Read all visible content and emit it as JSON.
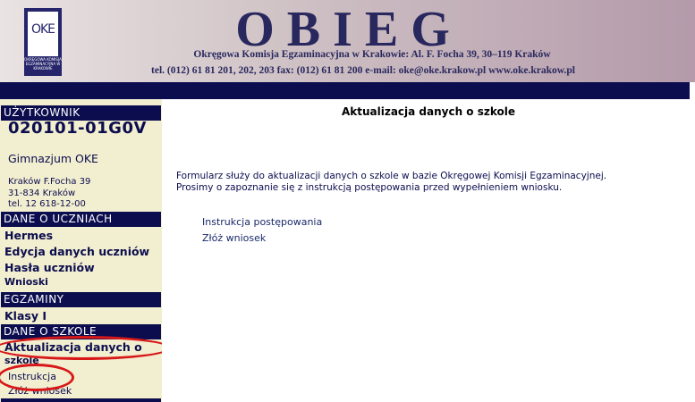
{
  "header": {
    "title": "OBIEG",
    "logo_letters": "OKE",
    "logo_text": "OKRĘGOWA KOMISJA EGZAMINACYJNA W KRAKOWIE",
    "subtitle": "Okręgowa Komisja Egzaminacyjna w Krakowie:  Al. F. Focha 39, 30–119 Kraków",
    "contact": "tel. (012) 61 81 201, 202, 203  fax: (012) 61 81 200  e-mail: oke@oke.krakow.pl   www.oke.krakow.pl"
  },
  "sidebar": {
    "user_header": "UŻYTKOWNIK",
    "user_code": "020101-01G0V",
    "school_name": "Gimnazjum OKE",
    "address_line1": "Kraków F.Focha 39",
    "address_line2": "31-834 Kraków",
    "address_line3": "tel. 12 618-12-00",
    "section_students": "DANE O UCZNIACH",
    "item_hermes": "Hermes",
    "item_edit_students": "Edycja danych uczniów",
    "item_passwords": "Hasła uczniów",
    "item_applications": "Wnioski",
    "section_exams": "EGZAMINY",
    "item_classes": "Klasy I",
    "section_school": "DANE O SZKOLE",
    "item_update_line1": "Aktualizacja danych o",
    "item_update_line2": "szkole",
    "subitem_instruction": "Instrukcja",
    "subitem_submit": "Złóż wniosek"
  },
  "main": {
    "title": "Aktualizacja danych o szkole",
    "paragraph_line1": "Formularz służy do aktualizacji danych o szkole w bazie Okręgowej Komisji Egzaminacyjnej.",
    "paragraph_line2": "Prosimy o zapoznanie się z instrukcją postępowania przed wypełnieniem wniosku.",
    "link_instruction": "Instrukcja postępowania",
    "link_submit": "Złóż wniosek"
  },
  "colors": {
    "navy": "#0b0d4e",
    "sidebar_bg": "#f2eed0",
    "highlight_red": "#d81818"
  }
}
